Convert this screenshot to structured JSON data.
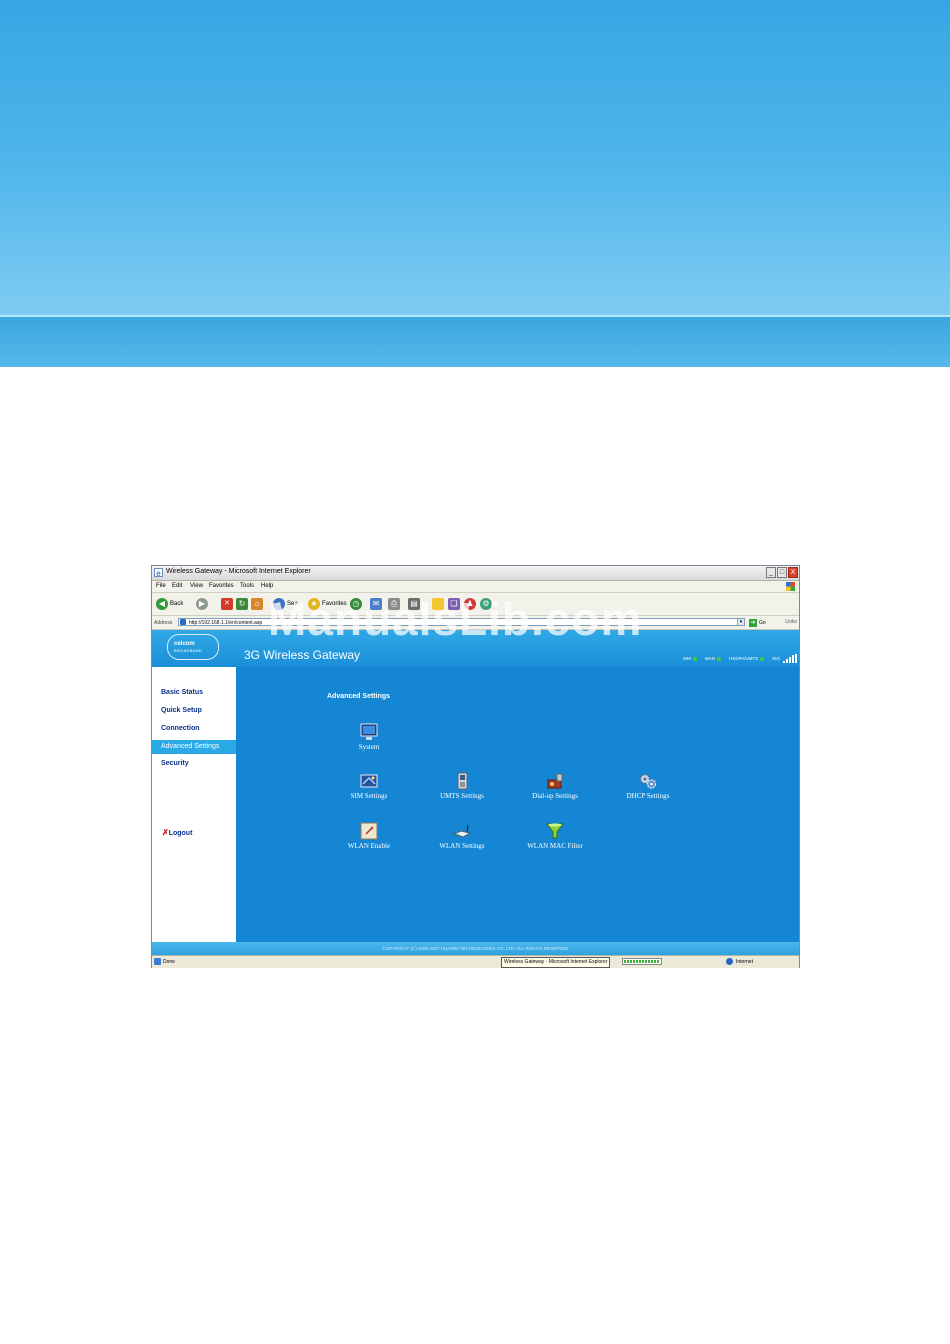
{
  "window": {
    "title": "Wireless Gateway - Microsoft Internet Explorer",
    "buttons": [
      "_",
      "□",
      "X"
    ]
  },
  "menu": [
    "File",
    "Edit",
    "View",
    "Favorites",
    "Tools",
    "Help"
  ],
  "toolbar": {
    "back": "Back",
    "search": "Sea",
    "favorites": "Favorites"
  },
  "address": {
    "label": "Address",
    "url": "http://192.168.1.1/en/content.asp",
    "go": "Go",
    "links": "Links"
  },
  "header": {
    "logo_line1": "celcom",
    "logo_line2": "BROADBAND",
    "gateway_title": "3G Wireless Gateway",
    "status": {
      "sim": "SIM",
      "wan": "WAN",
      "network": "HSDPA/UMTS",
      "signal": "SIG"
    }
  },
  "sidebar": {
    "items": [
      {
        "label": "Basic Status"
      },
      {
        "label": "Quick Setup"
      },
      {
        "label": "Connection"
      },
      {
        "label": "Advanced Settings"
      },
      {
        "label": "Security"
      }
    ],
    "logout": "Logout"
  },
  "main": {
    "heading": "Advanced Settings",
    "tiles": [
      {
        "label": "System",
        "icon": "monitor-icon"
      },
      {
        "label": "SIM Settings",
        "icon": "sim-card-icon"
      },
      {
        "label": "UMTS Settings",
        "icon": "phone-icon"
      },
      {
        "label": "Dial-up Settings",
        "icon": "dialup-icon"
      },
      {
        "label": "DHCP Settings",
        "icon": "gears-icon"
      },
      {
        "label": "WLAN Enable",
        "icon": "wlan-enable-icon"
      },
      {
        "label": "WLAN Settings",
        "icon": "router-icon"
      },
      {
        "label": "WLAN MAC Filter",
        "icon": "filter-icon"
      }
    ]
  },
  "footer": {
    "copyright": "COPYRIGHT (C) 2006-2007 HUAWEI TECHNOLOGIES CO.,LTD. ALL RIGHTS RESERVED"
  },
  "statusbar": {
    "left": "Done",
    "task": "Wireless Gateway - Microsoft Internet Explorer",
    "zone": "Internet"
  },
  "watermark": "ManualsLib.com",
  "colors": {
    "content_bg": "#1486d3",
    "nav_text": "#0b2f8a",
    "nav_active_bg": "#2aa9e6"
  }
}
